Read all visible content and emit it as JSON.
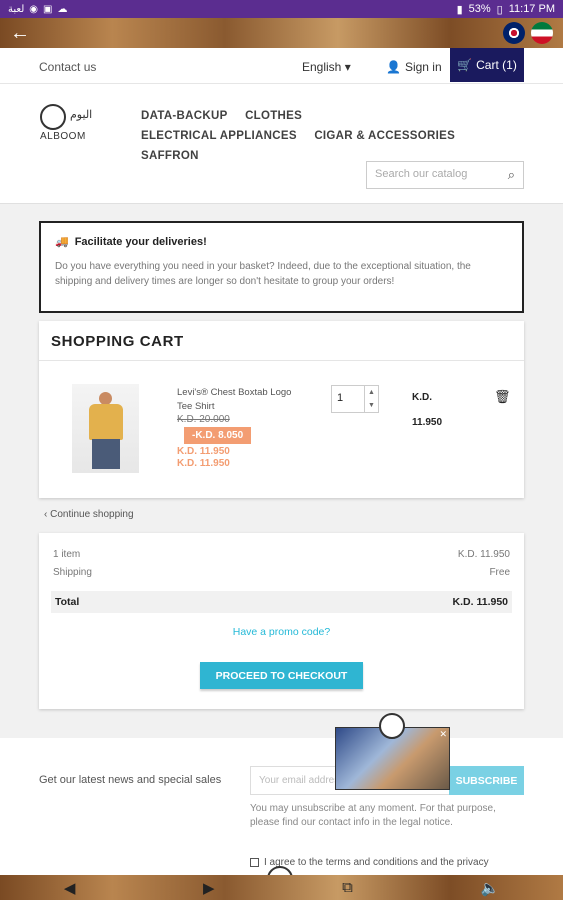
{
  "statusbar": {
    "time": "11:17 PM",
    "battery": "53%",
    "left_icons": "لعبة"
  },
  "appbar": {
    "back": "←"
  },
  "topnav": {
    "contact": "Contact us",
    "language": "English ▾",
    "signin": "Sign in",
    "cart": "Cart (1)"
  },
  "logo": {
    "arabic": "اليوم",
    "english": "ALBOOM"
  },
  "menu": [
    "DATA-BACKUP",
    "CLOTHES",
    "ELECTRICAL APPLIANCES",
    "CIGAR & ACCESSORIES",
    "SAFFRON"
  ],
  "search": {
    "placeholder": "Search our catalog"
  },
  "notice": {
    "title": "Facilitate your deliveries!",
    "body": "Do you have everything you need in your basket? Indeed, due to the exceptional situation, the shipping and delivery times are longer so don't hesitate to group your orders!"
  },
  "cart": {
    "heading": "SHOPPING CART",
    "item": {
      "name": "Levi's® Chest Boxtab Logo Tee Shirt",
      "old_price": "K.D. 20.000",
      "discount": "-K.D. 8.050",
      "price_line1": "K.D. 11.950",
      "price_line2": "K.D. 11.950",
      "quantity": "1",
      "unit_label": "K.D.",
      "total": "11.950"
    }
  },
  "continue_shopping": "Continue shopping",
  "summary": {
    "items_label": "1 item",
    "items_value": "K.D. 11.950",
    "shipping_label": "Shipping",
    "shipping_value": "Free",
    "total_label": "Total",
    "total_value": "K.D. 11.950",
    "promo": "Have a promo code?",
    "checkout": "PROCEED TO CHECKOUT"
  },
  "footer": {
    "news": "Get our latest news and special sales",
    "email_placeholder": "Your email address",
    "subscribe": "SUBSCRIBE",
    "unsub": "You may unsubscribe at any moment. For that purpose, please find our contact info in the legal notice.",
    "terms": "I agree to the terms and conditions and the privacy"
  },
  "colors": {
    "accent": "#2fb5d2",
    "cart_bg": "#1a1a5e",
    "discount": "#f39d72",
    "statusbar": "#5b2d90"
  }
}
